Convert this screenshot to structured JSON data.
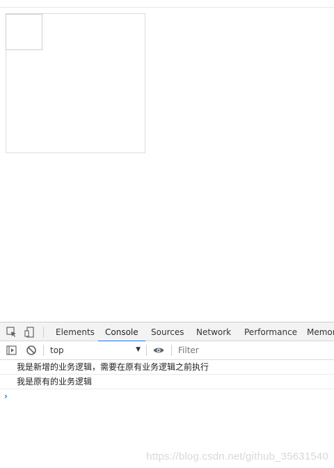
{
  "devtools": {
    "tabs": [
      {
        "label": "Elements"
      },
      {
        "label": "Console",
        "active": true
      },
      {
        "label": "Sources"
      },
      {
        "label": "Network"
      },
      {
        "label": "Performance"
      },
      {
        "label": "Memor"
      }
    ],
    "toolbar": {
      "context": "top",
      "filter_placeholder": "Filter"
    },
    "console": {
      "lines": [
        "我是新增的业务逻辑，需要在原有业务逻辑之前执行",
        "我是原有的业务逻辑"
      ],
      "prompt": "›"
    },
    "icons": {
      "inspect": "element-picker-icon",
      "device": "device-toggle-icon",
      "sidebar": "sidebar-toggle-icon",
      "clear": "clear-console-icon",
      "eye": "eye-icon"
    },
    "colors": {
      "accent": "#1a73e8",
      "tabbar_bg": "#f3f3f3"
    }
  },
  "watermark": "https://blog.csdn.net/github_35631540"
}
